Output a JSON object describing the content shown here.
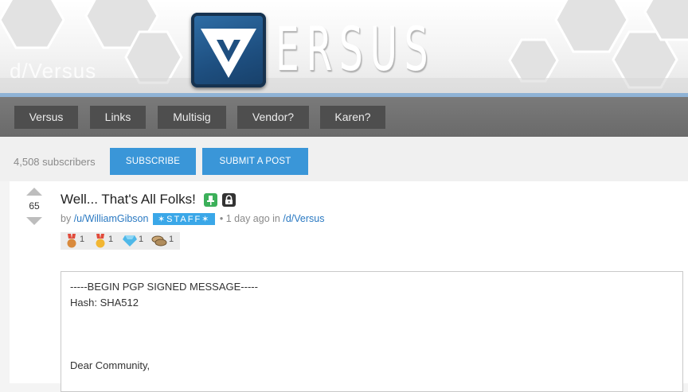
{
  "header": {
    "community_title": "d/Versus",
    "logo_word": "ERSUS",
    "accent_color": "#3a96d8"
  },
  "nav": {
    "items": [
      {
        "label": "Versus"
      },
      {
        "label": "Links"
      },
      {
        "label": "Multisig"
      },
      {
        "label": "Vendor?"
      },
      {
        "label": "Karen?"
      }
    ]
  },
  "subbar": {
    "subscribers": "4,508 subscribers",
    "subscribe_label": "SUBSCRIBE",
    "submit_label": "SUBMIT A POST"
  },
  "post": {
    "score": "65",
    "title": "Well... That's All Folks!",
    "icons": [
      "pin-icon",
      "lock-icon"
    ],
    "by_prefix": "by",
    "author": "/u/WilliamGibson",
    "badge": "✶STAFF✶",
    "time": "• 1 day ago in",
    "community": "/d/Versus",
    "awards": [
      {
        "icon": "bronze-medal-icon",
        "count": "1"
      },
      {
        "icon": "gold-medal-icon",
        "count": "1"
      },
      {
        "icon": "diamond-icon",
        "count": "1"
      },
      {
        "icon": "coins-icon",
        "count": "1"
      }
    ],
    "body_lines": [
      "-----BEGIN PGP SIGNED MESSAGE-----",
      "Hash: SHA512",
      "",
      "",
      "Dear Community,"
    ]
  }
}
